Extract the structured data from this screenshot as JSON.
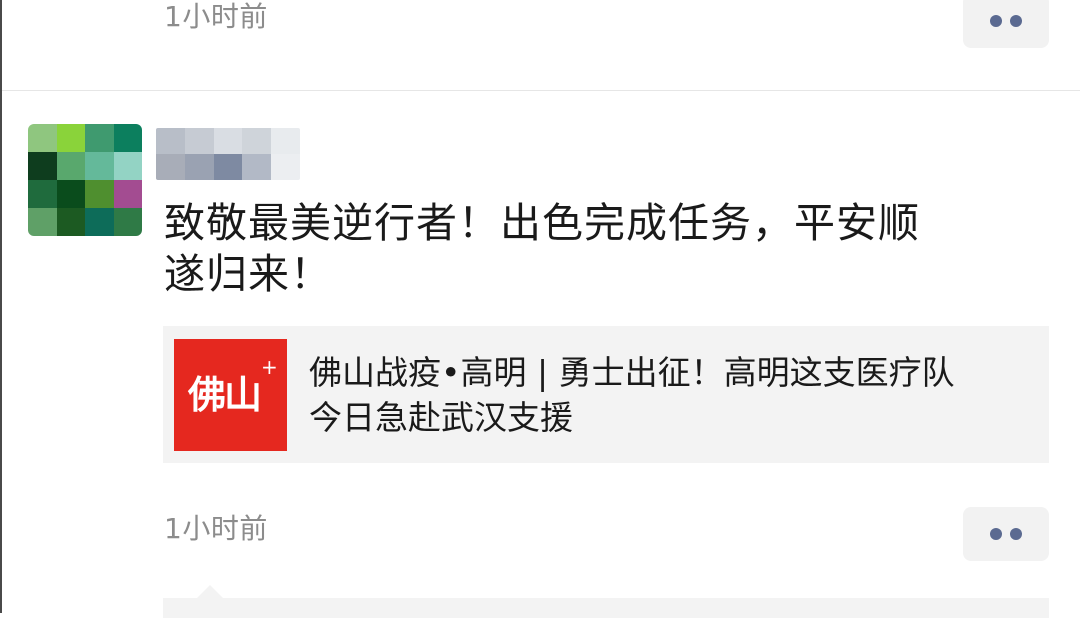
{
  "previous_post": {
    "timestamp": "1小时前",
    "more_icon": "more-dots-icon"
  },
  "post": {
    "avatar_colors": [
      "#8fc67f",
      "#8ad33a",
      "#3f9a6f",
      "#0c7f5e",
      "#0e3d1e",
      "#59a86d",
      "#64b99a",
      "#93d3c4",
      "#1f6b3d",
      "#0a4c1c",
      "#4f8f2f",
      "#a34c91",
      "#5fa067",
      "#1c5a22",
      "#0d6c59",
      "#2f7a46"
    ],
    "nickname_colors": [
      "#b8bec8",
      "#c6cbd3",
      "#d9dde3",
      "#cfd4da",
      "#e8ebee",
      "#a8adb8",
      "#9aa2b2",
      "#7e8aa2",
      "#b2b9c6",
      "#eceef1"
    ],
    "text_lines": [
      "致敬最美逆行者！出色完成任务，平安顺",
      "遂归来！"
    ],
    "link": {
      "thumb_text": "佛山",
      "thumb_plus": "+",
      "thumb_color": "#e5281f",
      "title_lines": [
        "佛山战疫•高明 | 勇士出征！高明这支医疗队",
        "今日急赴武汉支援"
      ]
    },
    "timestamp": "1小时前",
    "more_icon": "more-dots-icon"
  }
}
